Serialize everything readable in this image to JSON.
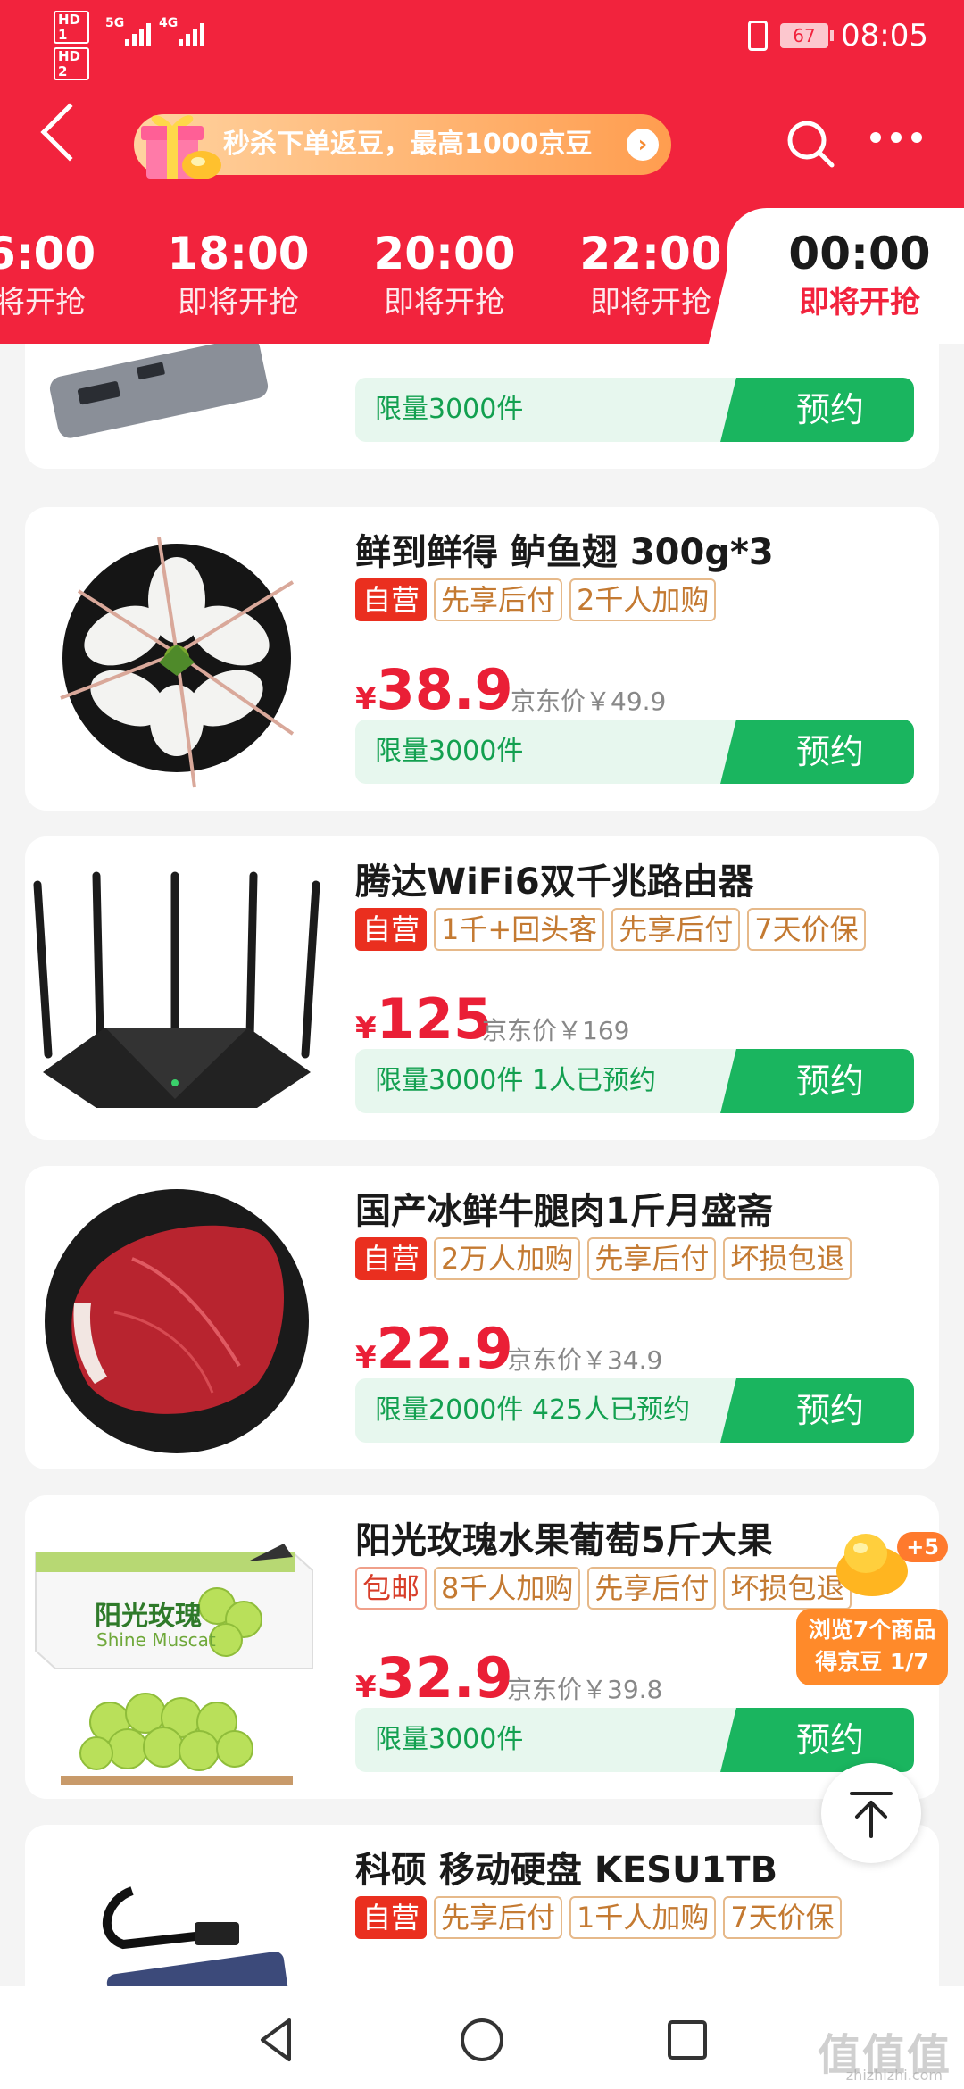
{
  "status_bar": {
    "hd1": "HD 1",
    "hd2": "HD 2",
    "net1": "5G",
    "net2": "4G",
    "battery": "67",
    "time": "08:05"
  },
  "header": {
    "promo_text_a": "秒杀下单返豆，最高",
    "promo_text_b": "1000",
    "promo_text_c": "京豆",
    "promo_arrow": "›"
  },
  "tabs": [
    {
      "time": "6:00",
      "status": "将开抢"
    },
    {
      "time": "18:00",
      "status": "即将开抢"
    },
    {
      "time": "20:00",
      "status": "即将开抢"
    },
    {
      "time": "22:00",
      "status": "即将开抢"
    },
    {
      "time": "00:00",
      "status": "即将开抢"
    }
  ],
  "products": [
    {
      "title": "",
      "tags": [],
      "currency": "",
      "price": "",
      "jd_price": "",
      "limit": "限量3000件",
      "button": "预约"
    },
    {
      "title": "鲜到鲜得 鲈鱼翅 300g*3",
      "tags": [
        "自营",
        "先享后付",
        "2千人加购"
      ],
      "currency": "¥",
      "price": "38.9",
      "jd_price": "京东价￥49.9",
      "limit": "限量3000件",
      "button": "预约"
    },
    {
      "title": "腾达WiFi6双千兆路由器",
      "tags": [
        "自营",
        "1千+回头客",
        "先享后付",
        "7天价保"
      ],
      "currency": "¥",
      "price": "125",
      "jd_price": "京东价￥169",
      "limit": "限量3000件 1人已预约",
      "button": "预约"
    },
    {
      "title": "国产冰鲜牛腿肉1斤月盛斋",
      "tags": [
        "自营",
        "2万人加购",
        "先享后付",
        "坏损包退"
      ],
      "currency": "¥",
      "price": "22.9",
      "jd_price": "京东价￥34.9",
      "limit": "限量2000件 425人已预约",
      "button": "预约"
    },
    {
      "title": "阳光玫瑰水果葡萄5斤大果",
      "tags": [
        "包邮",
        "8千人加购",
        "先享后付",
        "坏损包退"
      ],
      "currency": "¥",
      "price": "32.9",
      "jd_price": "京东价￥39.8",
      "limit": "限量3000件",
      "button": "预约",
      "box_title": "阳光玫瑰",
      "box_sub": "Shine Muscat"
    },
    {
      "title": "科硕 移动硬盘 KESU1TB",
      "tags": [
        "自营",
        "先享后付",
        "1千人加购",
        "7天价保"
      ],
      "currency": "",
      "price": "",
      "jd_price": "",
      "limit": "",
      "button": ""
    }
  ],
  "floating": {
    "plus": "+5",
    "line1": "浏览7个商品",
    "line2": "得京豆 1/7"
  },
  "watermark": {
    "text": "值值值",
    "url": "zhizhizhi.com"
  },
  "colors": {
    "brand_red": "#f2233d",
    "price_red": "#ea1f36",
    "green": "#1ab55f",
    "orange": "#ff8a2a"
  }
}
